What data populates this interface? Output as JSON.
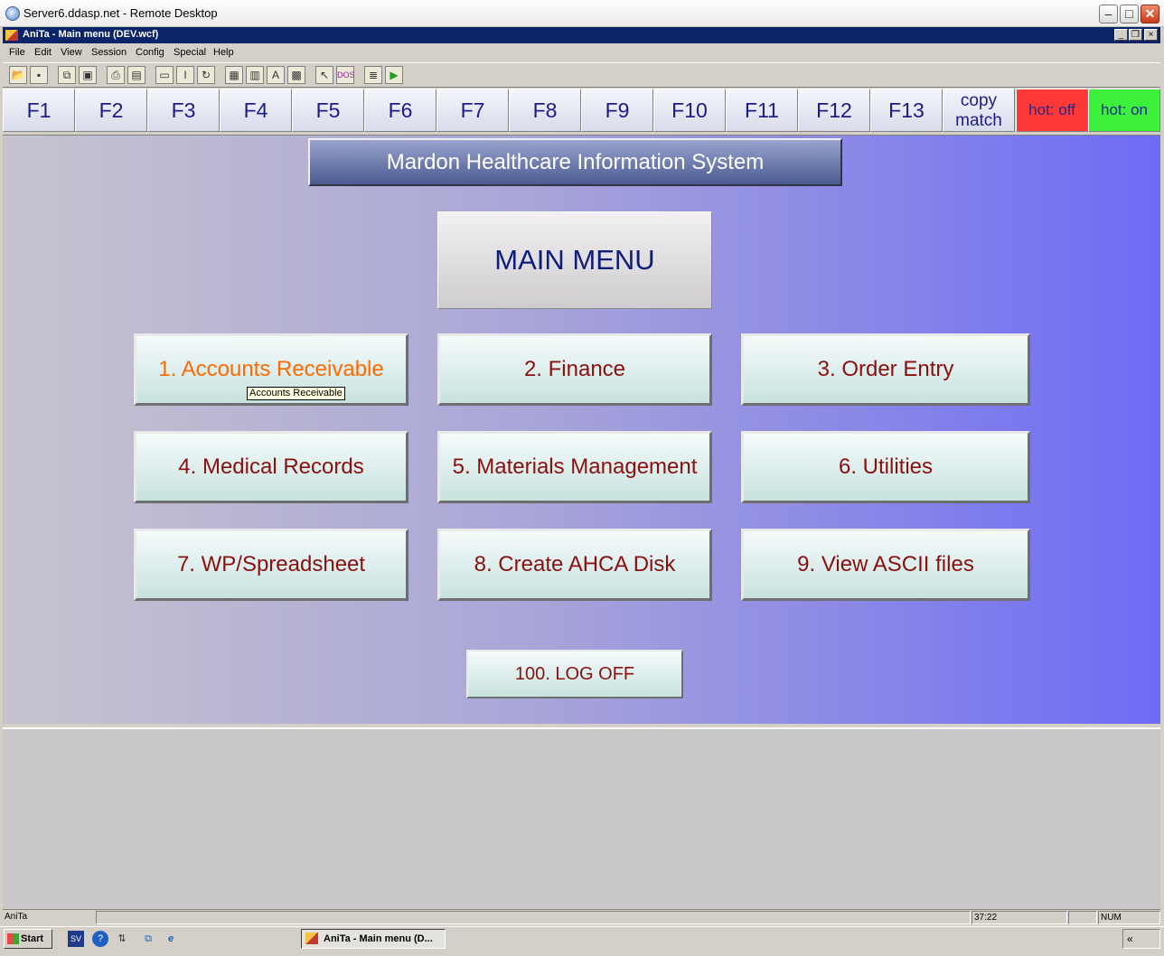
{
  "rdp_window": {
    "title": "Server6.ddasp.net - Remote Desktop"
  },
  "app_window": {
    "title": "AniTa - Main menu (DEV.wcf)"
  },
  "menubar": {
    "items": [
      "File",
      "Edit",
      "View",
      "Session",
      "Config",
      "Special",
      "Help"
    ]
  },
  "toolbar": {
    "icons": [
      "open-folder-icon",
      "save-icon",
      "copy-icon",
      "paste-icon",
      "print-icon",
      "print-preview-icon",
      "select-icon",
      "text-icon",
      "refresh-icon",
      "form-icon",
      "form-edit-icon",
      "font-icon",
      "grid-icon",
      "pointer-icon",
      "dos-icon",
      "database-icon",
      "run-icon"
    ],
    "dos_label": "DOS"
  },
  "fkeys": {
    "keys": [
      "F1",
      "F2",
      "F3",
      "F4",
      "F5",
      "F6",
      "F7",
      "F8",
      "F9",
      "F10",
      "F11",
      "F12",
      "F13"
    ],
    "copy_match_line1": "copy",
    "copy_match_line2": "match",
    "hot_off": "hot: off",
    "hot_on": "hot: on",
    "hot_off_color": "#ff3838",
    "hot_on_color": "#3cf03c"
  },
  "main": {
    "system_title": "Mardon Healthcare Information System",
    "menu_title": "MAIN MENU",
    "buttons": [
      "1. Accounts Receivable",
      "2. Finance",
      "3. Order Entry",
      "4. Medical Records",
      "5. Materials Management",
      "6. Utilities",
      "7. WP/Spreadsheet",
      "8. Create AHCA Disk",
      "9. View ASCII files"
    ],
    "tooltip": "Accounts Receivable",
    "logoff": "100. LOG OFF",
    "hover_color": "#ff6a00",
    "button_text_color": "#8a1010"
  },
  "statusbar": {
    "app": "AniTa",
    "time": "37:22",
    "num": "NUM"
  },
  "taskbar": {
    "start": "Start",
    "quicklaunch_sv": "SV",
    "task": "AniTa - Main menu (D...",
    "tray": "«"
  }
}
